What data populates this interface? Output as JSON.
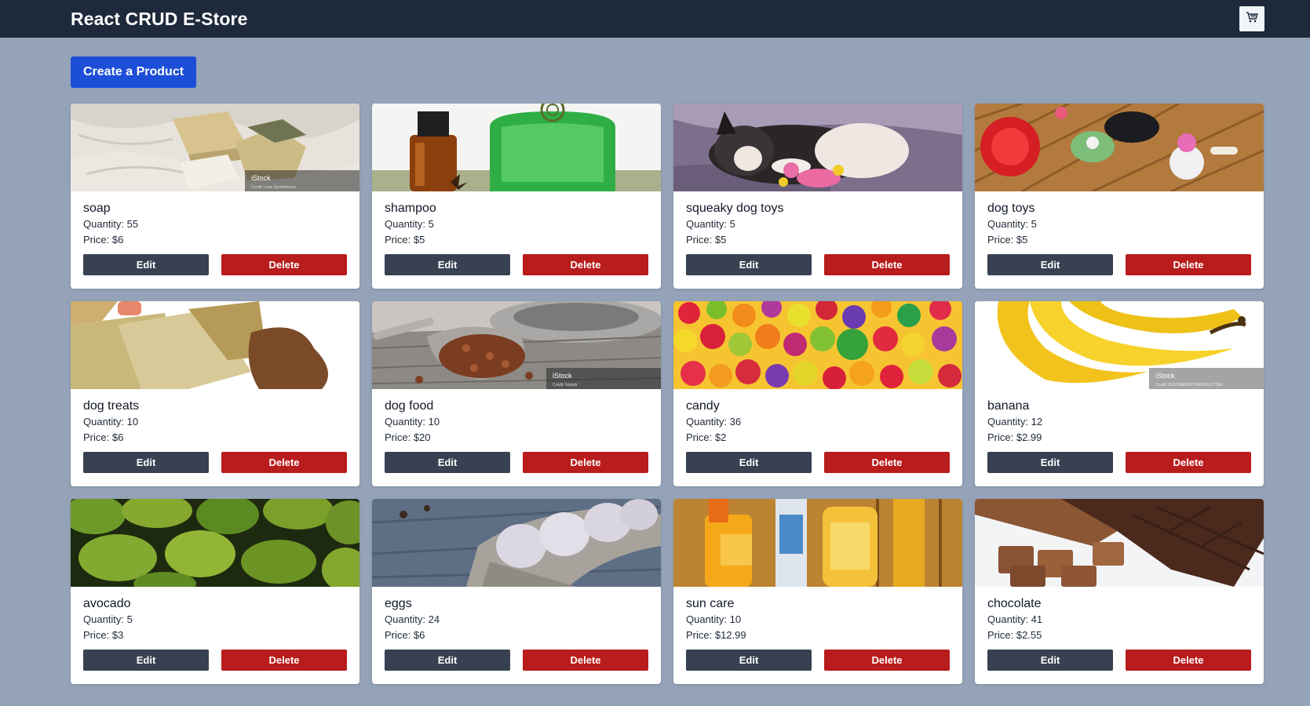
{
  "app": {
    "title": "React CRUD E-Store"
  },
  "icons": {
    "cart": "shopping-cart-icon"
  },
  "toolbar": {
    "create_label": "Create a Product"
  },
  "card_actions": {
    "edit_label": "Edit",
    "delete_label": "Delete"
  },
  "colors": {
    "navbar": "#1e293b",
    "page_bg": "#94a3b8",
    "primary": "#1d4ed8",
    "edit": "#374151",
    "delete": "#b91c1c"
  },
  "products": [
    {
      "name": "soap",
      "quantity": "Quantity: 55",
      "price": "Price: $6",
      "image": "soap"
    },
    {
      "name": "shampoo",
      "quantity": "Quantity: 5",
      "price": "Price: $5",
      "image": "shampoo"
    },
    {
      "name": "squeaky dog toys",
      "quantity": "Quantity: 5",
      "price": "Price: $5",
      "image": "squeaky-dog-toys"
    },
    {
      "name": "dog toys",
      "quantity": "Quantity: 5",
      "price": "Price: $5",
      "image": "dog-toys"
    },
    {
      "name": "dog treats",
      "quantity": "Quantity: 10",
      "price": "Price: $6",
      "image": "dog-treats"
    },
    {
      "name": "dog food",
      "quantity": "Quantity: 10",
      "price": "Price: $20",
      "image": "dog-food"
    },
    {
      "name": "candy",
      "quantity": "Quantity: 36",
      "price": "Price: $2",
      "image": "candy"
    },
    {
      "name": "banana",
      "quantity": "Quantity: 12",
      "price": "Price: $2.99",
      "image": "banana"
    },
    {
      "name": "avocado",
      "quantity": "Quantity: 5",
      "price": "Price: $3",
      "image": "avocado"
    },
    {
      "name": "eggs",
      "quantity": "Quantity: 24",
      "price": "Price: $6",
      "image": "eggs"
    },
    {
      "name": "sun care",
      "quantity": "Quantity: 10",
      "price": "Price: $12.99",
      "image": "sun-care"
    },
    {
      "name": "chocolate",
      "quantity": "Quantity: 41",
      "price": "Price: $2.55",
      "image": "chocolate"
    }
  ]
}
